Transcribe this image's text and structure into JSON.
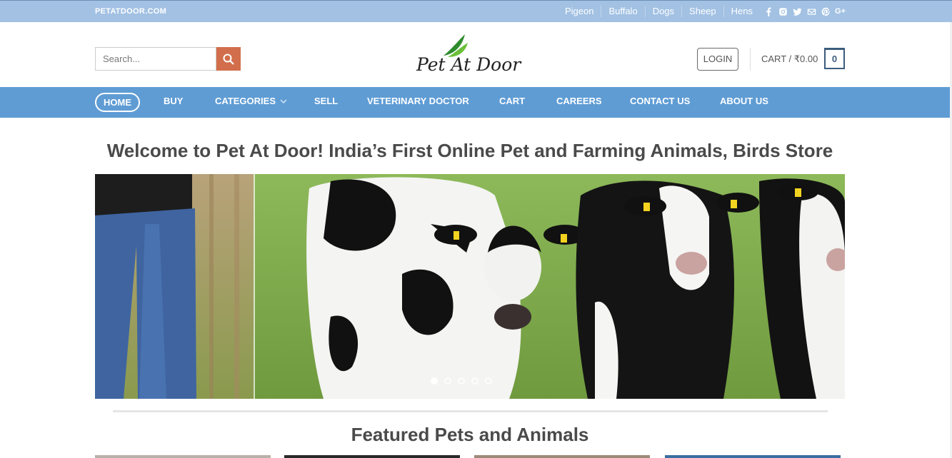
{
  "topbar": {
    "brand": "PETATDOOR.COM",
    "links": [
      "Pigeon",
      "Buffalo",
      "Dogs",
      "Sheep",
      "Hens"
    ],
    "social_icons": [
      "facebook-icon",
      "instagram-icon",
      "twitter-icon",
      "email-icon",
      "pinterest-icon",
      "google-plus-icon"
    ]
  },
  "header": {
    "search_placeholder": "Search...",
    "logo_text": "Pet At Door",
    "login_label": "LOGIN",
    "cart_label": "CART / ₹0.00",
    "cart_count": "0"
  },
  "nav": {
    "items": [
      "HOME",
      "BUY",
      "CATEGORIES",
      "SELL",
      "VETERINARY DOCTOR",
      "CART",
      "CAREERS",
      "CONTACT US",
      "ABOUT US"
    ]
  },
  "main": {
    "welcome": "Welcome to Pet At Door! India’s First Online Pet and Farming Animals, Birds Store",
    "featured_title": "Featured Pets and Animals",
    "slider_dot_count": 5
  },
  "colors": {
    "topbar": "#a2c1e3",
    "nav": "#5f9cd4",
    "search_button": "#d26e4b",
    "cart_border": "#3c5c7e"
  }
}
